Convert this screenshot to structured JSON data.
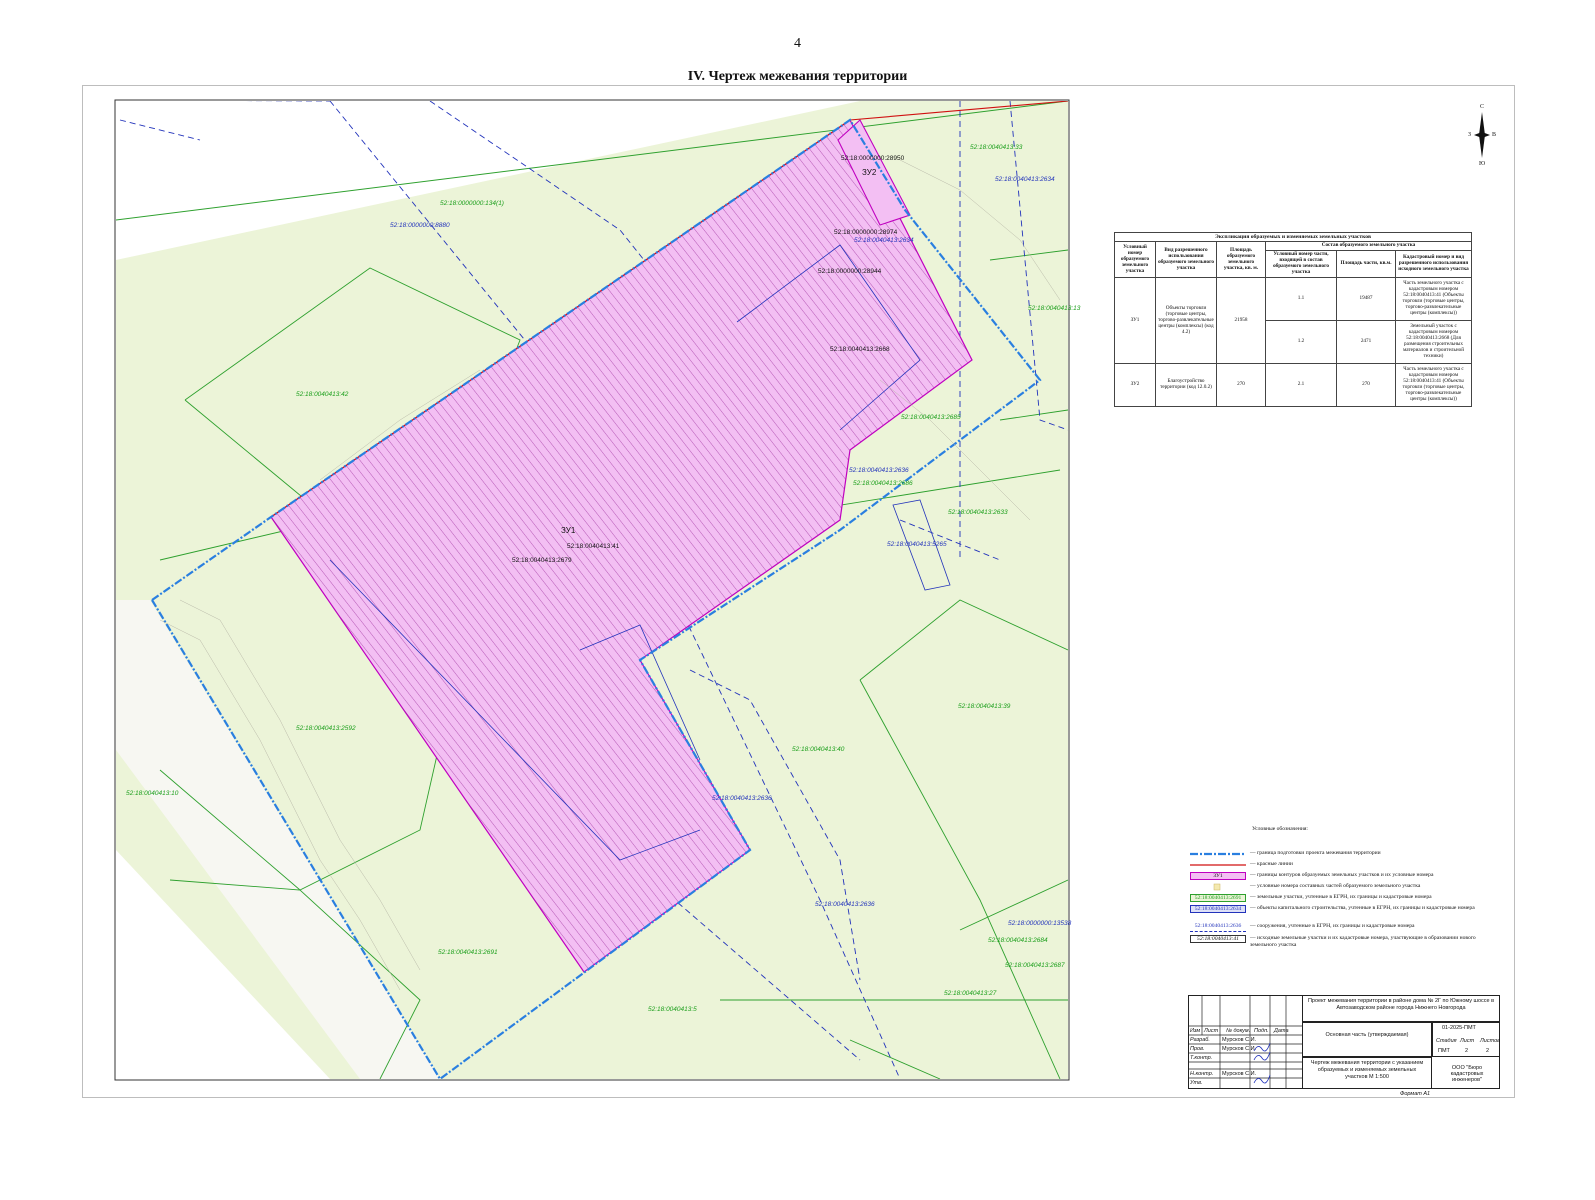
{
  "page": {
    "number": "4",
    "title": "IV.  Чертеж межевания территории"
  },
  "colors": {
    "land": "#ecf4d8",
    "plot": "#f3bff3",
    "plot_border": "#c000c0",
    "project": "#2a7fe0",
    "red_line": "#d01010",
    "egrn": "#1a9e1a",
    "capital": "#2233bb"
  },
  "map": {
    "plot_labels": {
      "zu1": "ЗУ1",
      "zu2": "ЗУ2"
    },
    "labels_green": [
      "52:18:0000000:134(1)",
      "52:18:0040413:42",
      "52:18:0040413:2592",
      "52:18:0040413:10",
      "52:18:0040413:2691",
      "52:18:0040413:5",
      "52:18:0040413:40",
      "52:18:0040413:39",
      "52:18:0040413:2633",
      "52:18:0040413:33",
      "52:18:0040413:2685",
      "52:18:0040413:2686",
      "52:18:0040413:2684",
      "52:18:0040413:2687",
      "52:18:0040413:27",
      "52:18:0040413:13"
    ],
    "labels_blue": [
      "52:18:0000000:8880",
      "52:18:0040413:2634",
      "52:18:0040413:2636",
      "52:18:0040413:2636",
      "52:18:0040413:2634",
      "52:18:0040413:5265",
      "52:18:0000000:13538",
      "52:18:0040413:2636"
    ],
    "labels_black": [
      "52:18:0000000:28950",
      "52:18:0000000:28974",
      "52:18:0000000:28944",
      "52:18:0040413:2668",
      "52:18:0040413:41",
      "52:18:0040413:2679"
    ]
  },
  "compass": {
    "n": "С",
    "s": "Ю",
    "w": "З",
    "e": "В"
  },
  "explication": {
    "caption": "Экспликация образуемых и изменяемых земельных участков",
    "h_num": "Условный номер образуемого земельного участка",
    "h_use": "Вид разрешенного использования образуемого земельного участка",
    "h_area": "Площадь образуемого земельного участка, кв. м.",
    "h_comp": "Состав образуемого земельного участка",
    "h_part": "Условный номер части, входящей в состав образуемого земельного участка",
    "h_parea": "Площадь части, кв.м.",
    "h_cad": "Кадастровый номер и вид разрешенного использования исходного земельного участка",
    "rows": [
      {
        "num": "ЗУ1",
        "use": "Объекты торговли (торговые центры, торгово-развлекательные центры (комплексы) (код 4.2)",
        "area": "21958",
        "p1": "1.1",
        "a1": "19487",
        "c1": "Часть земельного участка с кадастровым номером 52:18:0040413:41 (Объекты торговли (торговые центры, торгово-развлекательные центры (комплексы))",
        "p2": "1.2",
        "a2": "2471",
        "c2": "Земельный участок с кадастровым номером 52:18:0040413:2668 (Для размещения строительных материалов и строительной техники)"
      },
      {
        "num": "ЗУ2",
        "use": "Благоустройство территории (код 12.0.2)",
        "area": "270",
        "p1": "2.1",
        "a1": "270",
        "c1": "Часть земельного участка с кадастровым номером 52:18:0040413:41 (Объекты торговли (торговые центры, торгово-развлекательные центры (комплексы))"
      }
    ]
  },
  "legend": {
    "title": "Условные обозначения:",
    "items": [
      {
        "sym": "",
        "text": "— граница подготовки проекта межевания территории"
      },
      {
        "sym": "",
        "text": "— красные линии"
      },
      {
        "sym": "ЗУ1",
        "text": "— границы контуров образуемых земельных участков и их условные номера"
      },
      {
        "sym": "",
        "text": "— условные номера составных частей образуемого земельного участка"
      },
      {
        "sym": "52:18:0040413:2691",
        "text": "— земельные участки, учтенные в ЕГРН, их границы и кадастровые номера"
      },
      {
        "sym": "52:18:0040413:2634",
        "text": "— объекты капитального строительства, учтенные в ЕГРН, их границы и кадастровые номера"
      },
      {
        "sym": "52:18:0040413:2636",
        "text": "— сооружения, учтенные в ЕГРН, их границы и кадастровые номера"
      },
      {
        "sym": "52:18:0040413:41",
        "text": "— исходные земельные участки и их кадастровые номера, участвующие в образовании нового земельного участка"
      }
    ]
  },
  "stamp": {
    "project": "Проект межевания территории в районе дома № 2Г по Южному шоссе в Автозаводском районе города Нижнего Новгорода",
    "code": "01-2025-ПМТ",
    "part": "Основная часть (утверждаемая)",
    "drawing": "Чертеж межевания территории с указанием образуемых и изменяемых земельных участков М 1:500",
    "org": "ООО \"Бюро кадастровых инженеров\"",
    "h_izm": "Изм",
    "h_list": "Лист",
    "h_doc": "№ докум.",
    "h_sign": "Подп.",
    "h_date": "Дата",
    "r1": "Разраб.",
    "r2": "Пров.",
    "r3": "Т.контр.",
    "r4": "Н.контр.",
    "r5": "Утв.",
    "person": "Мурсков С.И.",
    "h_stage": "Стадия",
    "h_sheet": "Лист",
    "h_sheets": "Листов",
    "stage": "ПМТ",
    "sheet": "2",
    "sheets": "2",
    "format": "Формат А1"
  }
}
